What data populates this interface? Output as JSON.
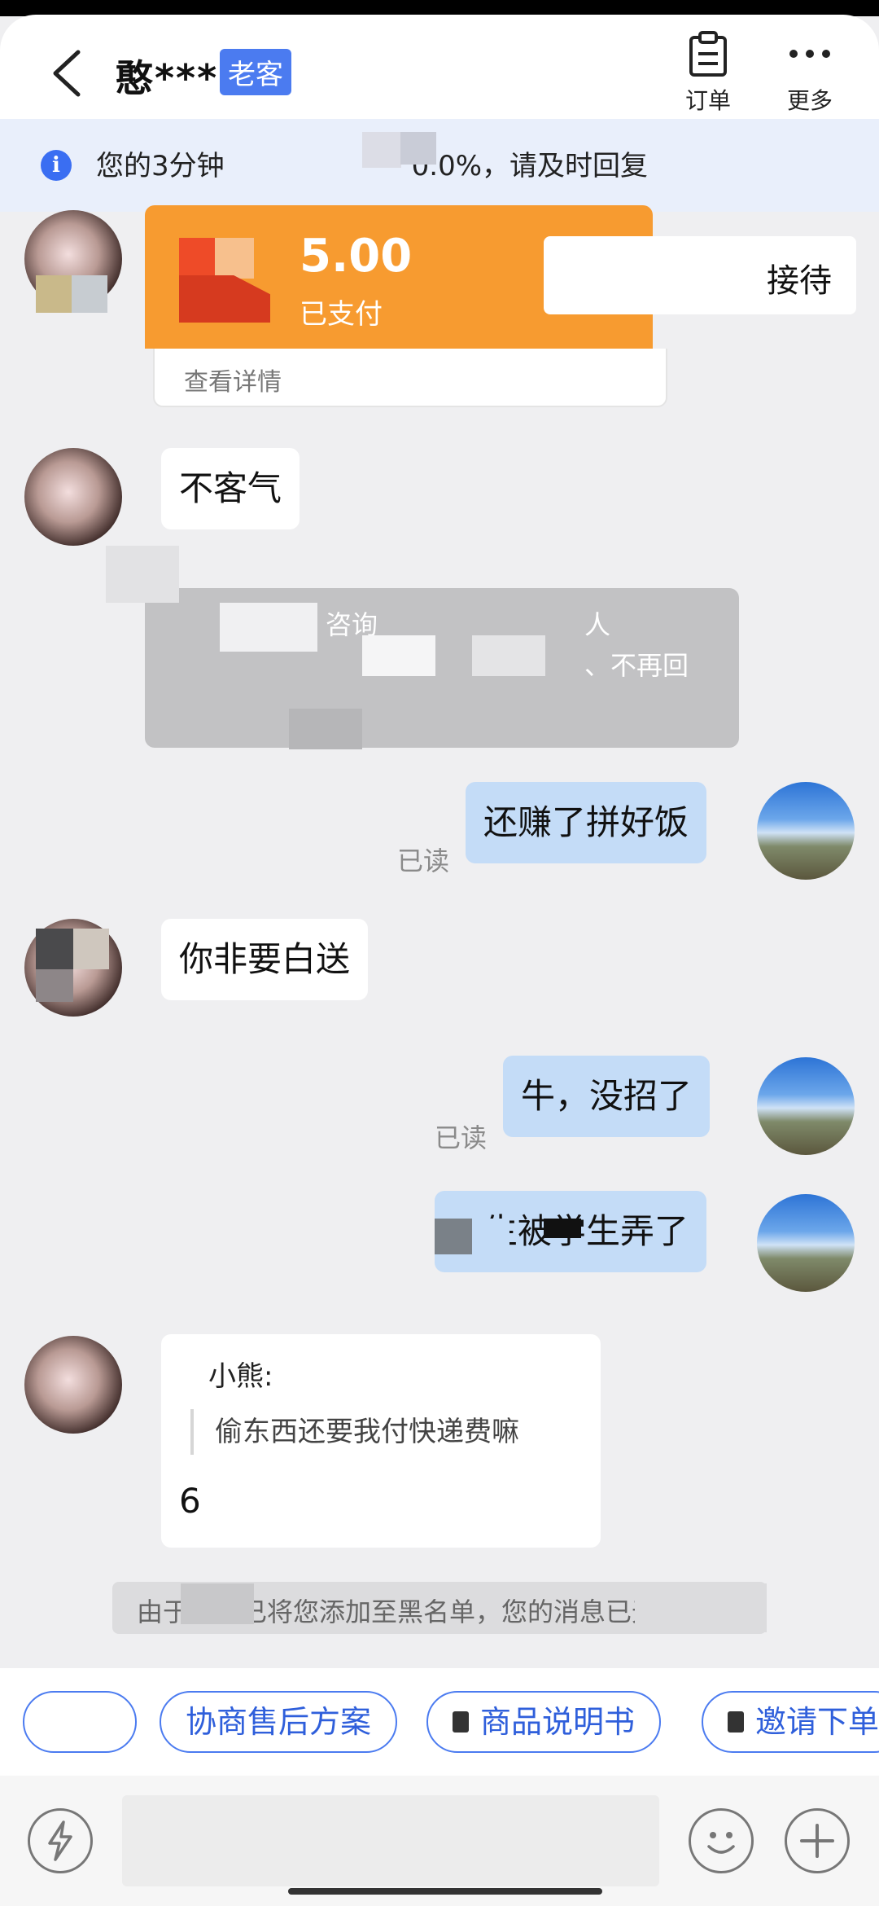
{
  "header": {
    "title": "憨***",
    "badge": "老客",
    "orders_label": "订单",
    "more_label": "更多"
  },
  "notice": {
    "text_prefix": "您的3分钟",
    "text_suffix": "0.0%，请及时回复"
  },
  "order_card": {
    "amount": "5.00",
    "status": "已支付",
    "details_link": "查看详情",
    "reception_label": "接待"
  },
  "system_card": {
    "fragment_1": "咨询",
    "fragment_2": "人",
    "fragment_3": "、不再回"
  },
  "messages": [
    {
      "side": "left",
      "text": "不客气"
    },
    {
      "side": "right",
      "text": "还赚了拼好饭",
      "status": "已读"
    },
    {
      "side": "left",
      "text": "你非要白送"
    },
    {
      "side": "right",
      "text": "牛，没招了",
      "status": "已读"
    },
    {
      "side": "right",
      "text": "生被学生弄了"
    }
  ],
  "quote_message": {
    "quoted_author": "小熊:",
    "quoted_text": "偷东西还要我付快递费嘛",
    "reply": "6"
  },
  "blacklist_notice": "由于对方已将您添加至黑名单，您的消息已无法送达",
  "chips": [
    {
      "label": ""
    },
    {
      "label": "协商售后方案"
    },
    {
      "label": "商品说明书"
    },
    {
      "label": "邀请下单"
    }
  ],
  "input": {
    "placeholder": ""
  },
  "colors": {
    "accent": "#4b7bf0",
    "outgoing_bubble": "#c4dcf7",
    "incoming_bubble": "#ffffff",
    "order_orange": "#f79b30"
  }
}
